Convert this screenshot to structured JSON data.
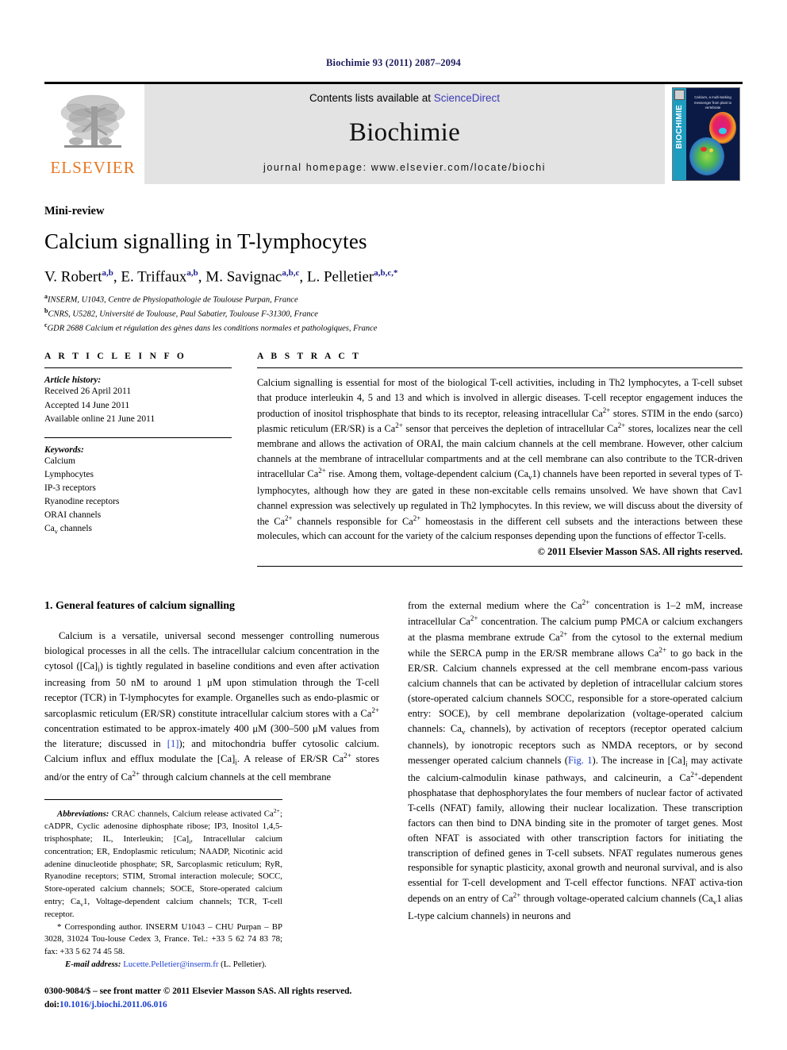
{
  "running_head": "Biochimie 93 (2011) 2087–2094",
  "banner": {
    "publisher_wordmark": "ELSEVIER",
    "contents_prefix": "Contents lists available at ",
    "contents_link": "ScienceDirect",
    "journal_name": "Biochimie",
    "homepage": "journal homepage: www.elsevier.com/locate/biochi",
    "cover": {
      "spine_text": "BIOCHIMIE",
      "cover_title": "Calcium, a multi-tasking messenger from plant to vertebrate"
    }
  },
  "article": {
    "kicker": "Mini-review",
    "title": "Calcium signalling in T-lymphocytes",
    "authors": [
      {
        "name": "V. Robert",
        "sup": "a,b",
        "sep": ", "
      },
      {
        "name": "E. Triffaux",
        "sup": "a,b",
        "sep": ", "
      },
      {
        "name": "M. Savignac",
        "sup": "a,b,c",
        "sep": ", "
      },
      {
        "name": "L. Pelletier",
        "sup": "a,b,c,*",
        "sep": ""
      }
    ],
    "affiliations": [
      {
        "mark": "a",
        "text": "INSERM, U1043, Centre de Physiopathologie de Toulouse Purpan, France"
      },
      {
        "mark": "b",
        "text": "CNRS, U5282, Université de Toulouse, Paul Sabatier, Toulouse F-31300, France"
      },
      {
        "mark": "c",
        "text": "GDR 2688 Calcium et régulation des gènes dans les conditions normales et pathologiques, France"
      }
    ]
  },
  "article_info": {
    "heading": "A R T I C L E   I N F O",
    "history_label": "Article history:",
    "history": [
      "Received 26 April 2011",
      "Accepted 14 June 2011",
      "Available online 21 June 2011"
    ],
    "keywords_label": "Keywords:",
    "keywords": [
      "Calcium",
      "Lymphocytes",
      "IP-3 receptors",
      "Ryanodine receptors",
      "ORAI channels",
      "Cav channels"
    ]
  },
  "abstract": {
    "heading": "A B S T R A C T",
    "copyright": "© 2011 Elsevier Masson SAS. All rights reserved."
  },
  "body": {
    "section1_heading": "1.  General features of calcium signalling"
  },
  "footnotes": {
    "abbrev_label": "Abbreviations:",
    "corresponding_marker": "*",
    "email_label": "E-mail address:",
    "email": "Lucette.Pelletier@inserm.fr",
    "email_owner": "(L. Pelletier).",
    "issn": "0300-9084/$ – see front matter © 2011 Elsevier Masson SAS. All rights reserved.",
    "doi_label": "doi:",
    "doi": "10.1016/j.biochi.2011.06.016"
  },
  "colors": {
    "link_blue": "#1c3fd0",
    "header_navy": "#1c1c5e",
    "elsevier_orange": "#E87722",
    "banner_gray": "#e3e3e3"
  }
}
